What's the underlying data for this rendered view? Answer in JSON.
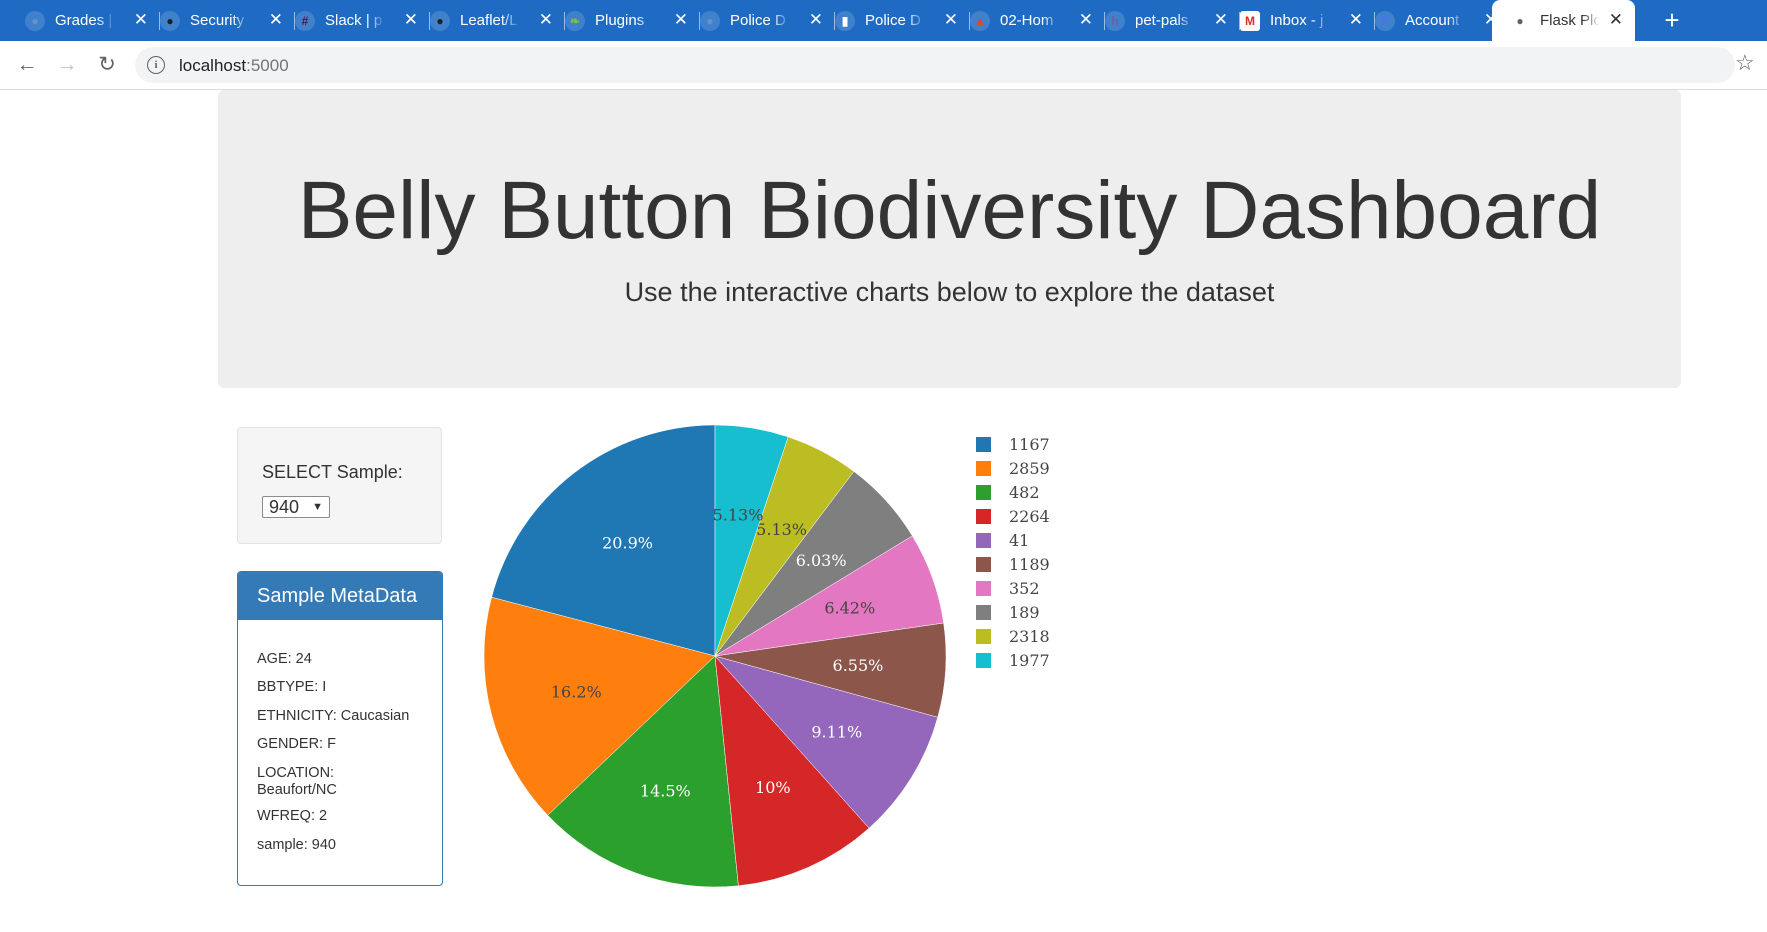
{
  "browser": {
    "tabs": [
      {
        "label": "Grades | ",
        "icon": "globe-icon",
        "color": "#6b8fc7"
      },
      {
        "label": "Security ",
        "icon": "github-icon",
        "color": "#1b1f23"
      },
      {
        "label": "Slack | p",
        "icon": "slack-icon",
        "color": "#4a154b"
      },
      {
        "label": "Leaflet/L",
        "icon": "github-icon",
        "color": "#1b1f23"
      },
      {
        "label": "Plugins ",
        "icon": "leaf-icon",
        "color": "#7cc142"
      },
      {
        "label": "Police D",
        "icon": "globe-icon",
        "color": "#6b8fc7"
      },
      {
        "label": "Police D",
        "icon": "page-icon",
        "color": "#ffffff"
      },
      {
        "label": "02-Hom",
        "icon": "gitlab-icon",
        "color": "#e24329"
      },
      {
        "label": "pet-pals",
        "icon": "heroku-icon",
        "color": "#79589f"
      },
      {
        "label": "Inbox - j",
        "icon": "gmail-icon",
        "color": "#ffffff"
      },
      {
        "label": "Account",
        "icon": "account-icon",
        "color": "#4c6ef5"
      },
      {
        "label": "Flask Plo",
        "icon": "globe-icon",
        "color": "#5f6368",
        "active": true
      }
    ],
    "url_host": "localhost",
    "url_port": ":5000"
  },
  "page": {
    "title": "Belly Button Biodiversity Dashboard",
    "subtitle": "Use the interactive charts below to explore the dataset"
  },
  "selector": {
    "label": "SELECT Sample:",
    "value": "940"
  },
  "metadata": {
    "heading": "Sample MetaData",
    "age": "AGE: 24",
    "bbtype": "BBTYPE: I",
    "ethnicity": "ETHNICITY: Caucasian",
    "gender": "GENDER: F",
    "location": "LOCATION: Beaufort/NC",
    "wfreq": "WFREQ: 2",
    "sample": "sample: 940"
  },
  "chart_data": {
    "type": "pie",
    "labels": [
      "1167",
      "2859",
      "482",
      "2264",
      "41",
      "1189",
      "352",
      "189",
      "2318",
      "1977"
    ],
    "values": [
      20.9,
      16.2,
      14.5,
      10,
      9.11,
      6.55,
      6.42,
      6.03,
      5.13,
      5.13
    ],
    "text_labels": [
      "20.9%",
      "16.2%",
      "14.5%",
      "10%",
      "9.11%",
      "6.55%",
      "6.42%",
      "6.03%",
      "5.13%",
      "5.13%"
    ],
    "colors": [
      "#1f77b4",
      "#ff7f0e",
      "#2ca02c",
      "#d62728",
      "#9467bd",
      "#8c564b",
      "#e377c2",
      "#7f7f7f",
      "#bcbd22",
      "#17becf"
    ],
    "label_colors": [
      "#ffffff",
      "#444444",
      "#ffffff",
      "#ffffff",
      "#ffffff",
      "#ffffff",
      "#444444",
      "#ffffff",
      "#444444",
      "#444444"
    ],
    "direction": "counterclockwise from top",
    "legend_position": "right"
  }
}
